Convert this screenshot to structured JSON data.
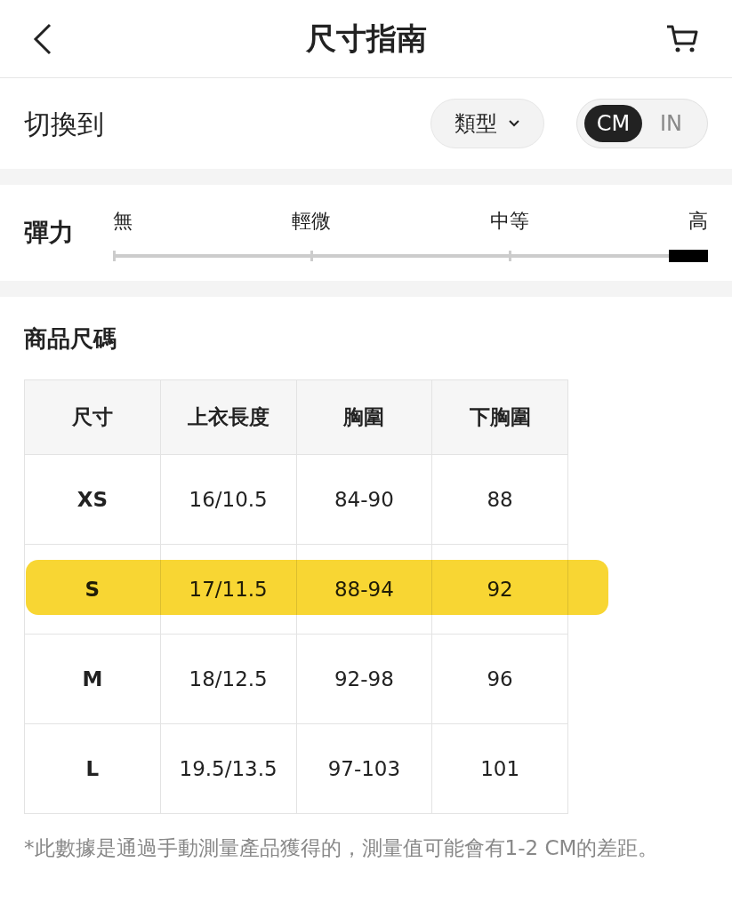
{
  "header": {
    "title": "尺寸指南"
  },
  "switch_row": {
    "label": "切換到",
    "type_dropdown": "類型",
    "units": [
      {
        "label": "CM",
        "selected": true
      },
      {
        "label": "IN",
        "selected": false
      }
    ]
  },
  "elasticity": {
    "label": "彈力",
    "levels": [
      {
        "label": "無",
        "selected": false
      },
      {
        "label": "輕微",
        "selected": false
      },
      {
        "label": "中等",
        "selected": false
      },
      {
        "label": "高",
        "selected": true
      }
    ]
  },
  "product_sizes": {
    "title": "商品尺碼",
    "columns": [
      "尺寸",
      "上衣長度",
      "胸圍",
      "下胸圍"
    ],
    "rows": [
      {
        "cells": [
          "XS",
          "16/10.5",
          "84-90",
          "88"
        ],
        "highlighted": false
      },
      {
        "cells": [
          "S",
          "17/11.5",
          "88-94",
          "92"
        ],
        "highlighted": true
      },
      {
        "cells": [
          "M",
          "18/12.5",
          "92-98",
          "96"
        ],
        "highlighted": false
      },
      {
        "cells": [
          "L",
          "19.5/13.5",
          "97-103",
          "101"
        ],
        "highlighted": false
      }
    ]
  },
  "footnote": "*此數據是通過手動測量產品獲得的，測量值可能會有1-2 CM的差距。"
}
